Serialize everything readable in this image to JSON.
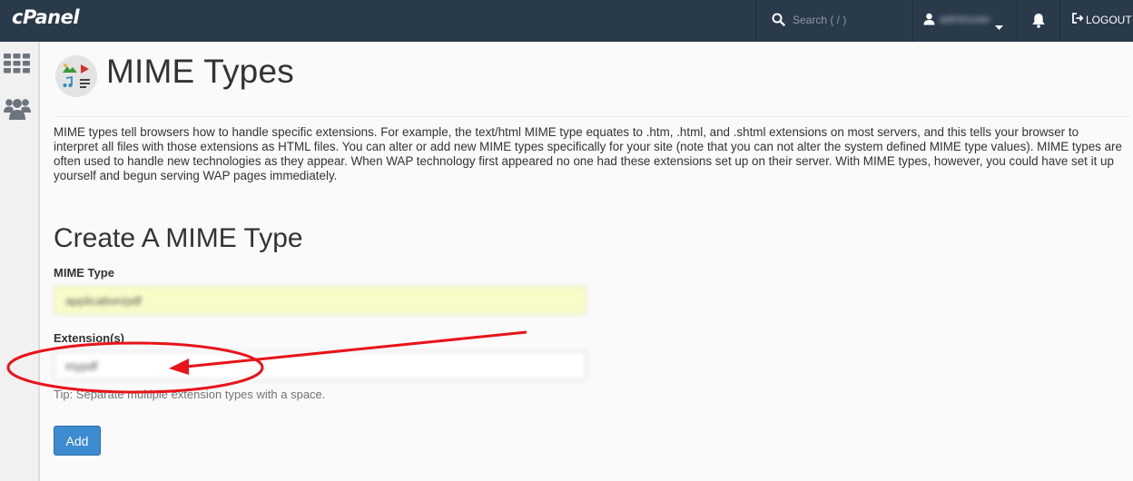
{
  "brand": "cPanel",
  "header": {
    "search_placeholder": "Search ( / )",
    "username": "adminuser",
    "logout_label": "LOGOUT"
  },
  "page": {
    "title": "MIME Types",
    "description": "MIME types tell browsers how to handle specific extensions. For example, the text/html MIME type equates to .htm, .html, and .shtml extensions on most servers, and this tells your browser to interpret all files with those extensions as HTML files. You can alter or add new MIME types specifically for your site (note that you can not alter the system defined MIME type values). MIME types are often used to handle new technologies as they appear. When WAP technology first appeared no one had these extensions set up on their server. With MIME types, however, you could have set it up yourself and begun serving WAP pages immediately."
  },
  "form": {
    "section_title": "Create A MIME Type",
    "mime_label": "MIME Type",
    "mime_value": "application/pdf",
    "extension_label": "Extension(s)",
    "extension_value": "mypdf",
    "tip": "Tip: Separate multiple extension types with a space.",
    "add_label": "Add"
  },
  "colors": {
    "topbar": "#293a4a",
    "primary_button": "#3d8bd0",
    "annotation": "#e8141a",
    "mime_input_bg": "#fafcc8"
  },
  "icons": [
    "search-icon",
    "user-icon",
    "caret-down-icon",
    "bell-icon",
    "logout-icon",
    "grid-icon",
    "users-icon",
    "mime-types-icon"
  ]
}
